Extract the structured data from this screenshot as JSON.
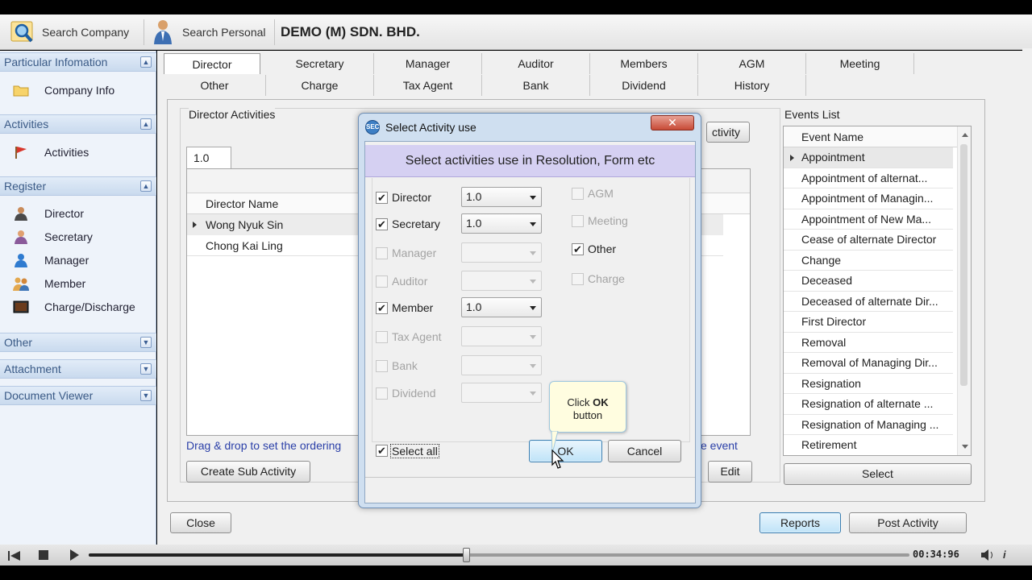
{
  "toolbar": {
    "search_company": "Search Company",
    "search_personal": "Search Personal",
    "company_name": "DEMO (M) SDN. BHD."
  },
  "sidebar": {
    "groups": {
      "particular": "Particular Infomation",
      "activities": "Activities",
      "register": "Register",
      "other": "Other",
      "attachment": "Attachment",
      "document_viewer": "Document Viewer"
    },
    "items": {
      "company_info": "Company Info",
      "activities": "Activities",
      "director": "Director",
      "secretary": "Secretary",
      "manager": "Manager",
      "member": "Member",
      "charge": "Charge/Discharge"
    }
  },
  "tabs": {
    "row1": [
      "Director",
      "Secretary",
      "Manager",
      "Auditor",
      "Members",
      "AGM",
      "Meeting"
    ],
    "row2": [
      "Other",
      "Charge",
      "Tax Agent",
      "Bank",
      "Dividend",
      "History"
    ]
  },
  "director_activities": {
    "title": "Director Activities",
    "version_tab": "1.0",
    "column": "Director Name",
    "rows": [
      "Wong Nyuk Sin",
      "Chong Kai Ling"
    ],
    "hint": "Drag & drop to set the ordering",
    "hint_right": "e event",
    "create_sub_button": "Create Sub Activity",
    "edit_button": "Edit",
    "partial_button": "ctivity"
  },
  "events": {
    "title": "Events List",
    "column": "Event Name",
    "items": [
      "Appointment",
      "Appointment of alternat...",
      "Appointment of Managin...",
      "Appointment of New Ma...",
      "Cease of alternate Director",
      "Change",
      "Deceased",
      "Deceased of alternate Dir...",
      "First Director",
      "Removal",
      "Removal of Managing Dir...",
      "Resignation",
      "Resignation of alternate ...",
      "Resignation of Managing ...",
      "Retirement"
    ],
    "select_button": "Select"
  },
  "footer": {
    "close": "Close",
    "reports": "Reports",
    "post_activity": "Post Activity"
  },
  "dialog": {
    "title": "Select Activity use",
    "banner": "Select activities use in Resolution, Form etc",
    "left": [
      {
        "label": "Director",
        "checked": true,
        "enabled": true,
        "value": "1.0"
      },
      {
        "label": "Secretary",
        "checked": true,
        "enabled": true,
        "value": "1.0"
      },
      {
        "label": "Manager",
        "checked": false,
        "enabled": false,
        "value": ""
      },
      {
        "label": "Auditor",
        "checked": false,
        "enabled": false,
        "value": ""
      },
      {
        "label": "Member",
        "checked": true,
        "enabled": true,
        "value": "1.0"
      },
      {
        "label": "Tax Agent",
        "checked": false,
        "enabled": false,
        "value": ""
      },
      {
        "label": "Bank",
        "checked": false,
        "enabled": false,
        "value": ""
      },
      {
        "label": "Dividend",
        "checked": false,
        "enabled": false,
        "value": ""
      }
    ],
    "right": [
      {
        "label": "AGM",
        "checked": false,
        "enabled": false
      },
      {
        "label": "Meeting",
        "checked": false,
        "enabled": false
      },
      {
        "label": "Other",
        "checked": true,
        "enabled": true
      },
      {
        "label": "Charge",
        "checked": false,
        "enabled": false
      }
    ],
    "select_all": "Select all",
    "ok": "OK",
    "cancel": "Cancel",
    "tooltip_pre": "Click ",
    "tooltip_bold": "OK",
    "tooltip_post": "button"
  },
  "player": {
    "time": "00:34:96",
    "progress": 0.46
  },
  "colors": {
    "accent": "#3c7fb1",
    "sidebar_header": "#c9daee",
    "dialog_banner": "#d5d0f2",
    "link_blue": "#2a3fa8"
  }
}
